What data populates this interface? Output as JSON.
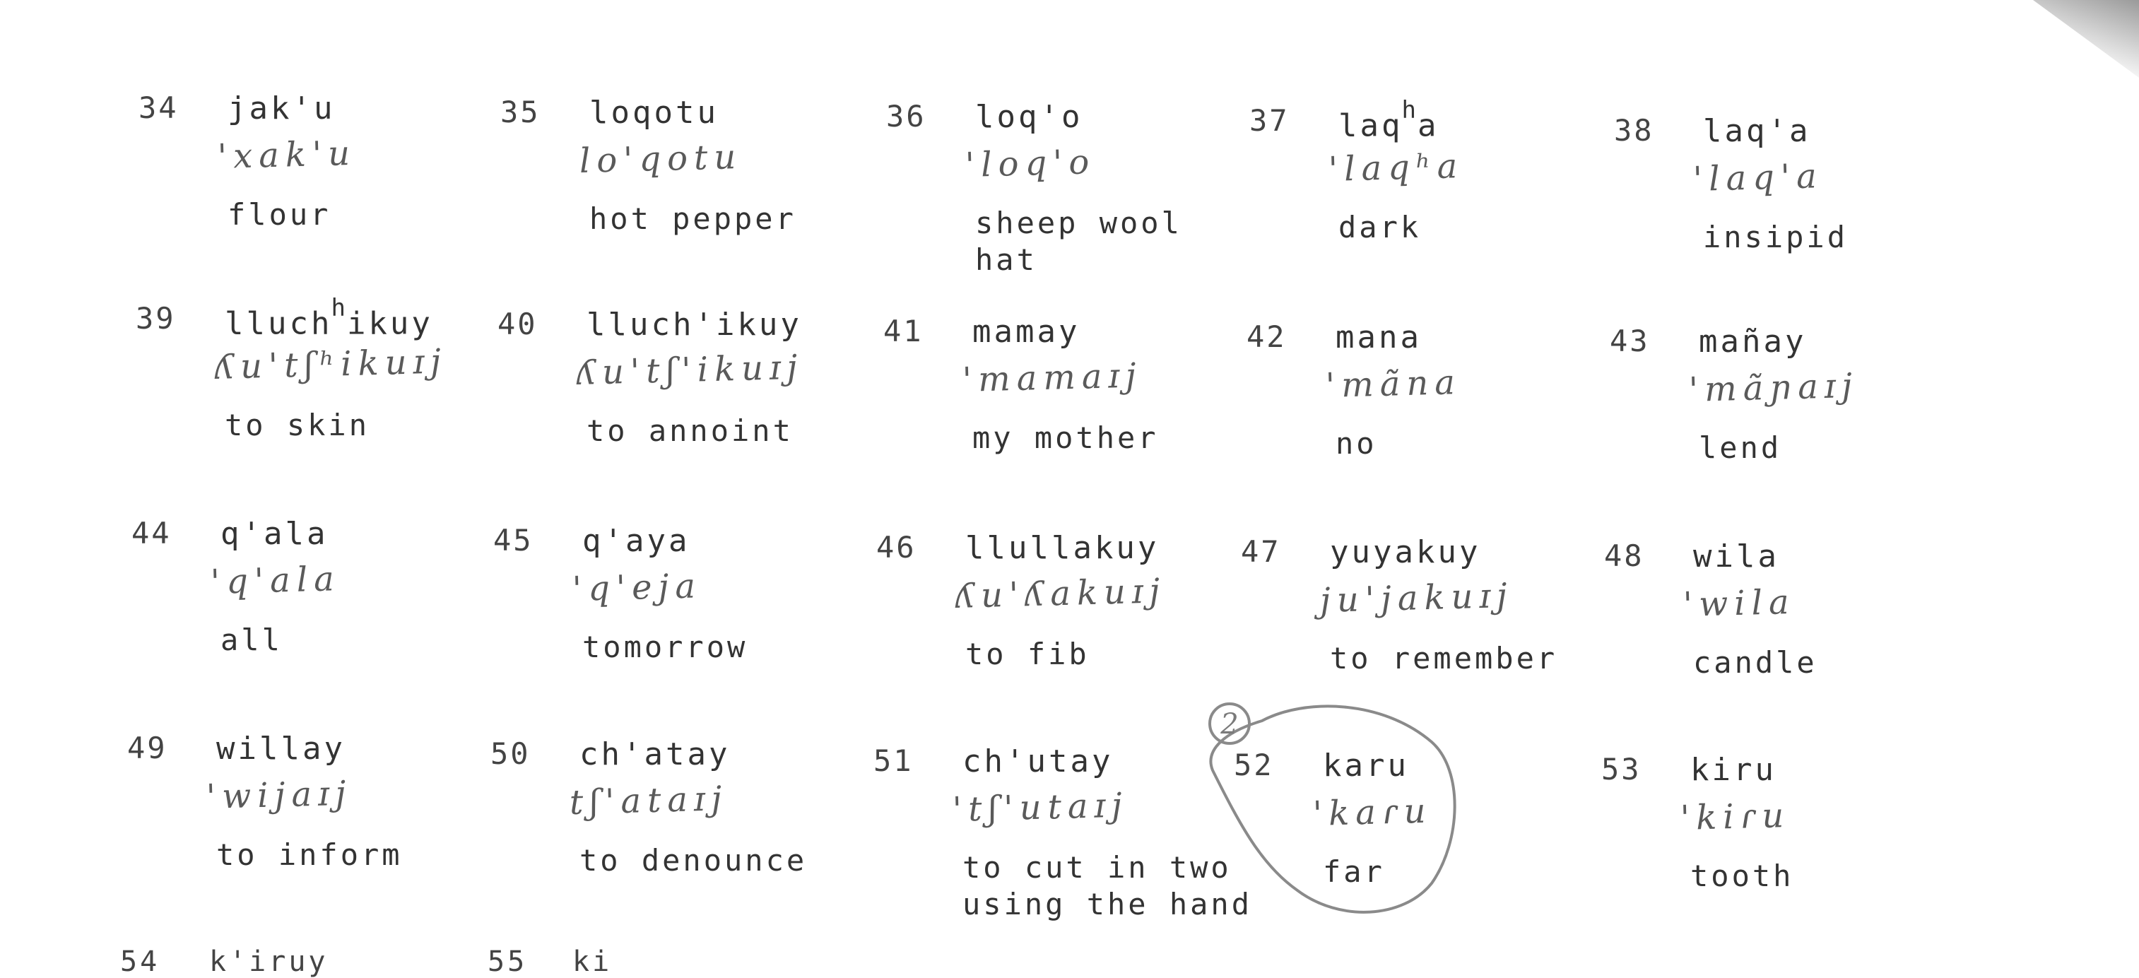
{
  "entries": [
    {
      "num": "34",
      "word": "jak'u",
      "ipa": "'xak'u",
      "gloss": "flour"
    },
    {
      "num": "35",
      "word": "loqotu",
      "ipa": "lo'qotu",
      "gloss": "hot pepper"
    },
    {
      "num": "36",
      "word": "loq'o",
      "ipa": "'loq'o",
      "gloss": "sheep wool\nhat"
    },
    {
      "num": "37",
      "word": "laq",
      "word_sup": "h",
      "word_rest": "a",
      "ipa": "'laqʰa",
      "gloss": "dark"
    },
    {
      "num": "38",
      "word": "laq'a",
      "ipa": "'laq'a",
      "gloss": "insipid"
    },
    {
      "num": "39",
      "word": "lluch",
      "word_sup": "h",
      "word_rest": "ikuy",
      "ipa": "ʎu'tʃʰikuɪj",
      "gloss": "to skin"
    },
    {
      "num": "40",
      "word": "lluch'ikuy",
      "ipa": "ʎu'tʃ'ikuɪj",
      "gloss": "to annoint"
    },
    {
      "num": "41",
      "word": "mamay",
      "ipa": "'mamaɪj",
      "gloss": "my mother"
    },
    {
      "num": "42",
      "word": "mana",
      "ipa": "'mãna",
      "gloss": "no"
    },
    {
      "num": "43",
      "word": "mañay",
      "ipa": "'mãɲaɪj",
      "gloss": "lend"
    },
    {
      "num": "44",
      "word": "q'ala",
      "ipa": "'q'ala",
      "gloss": "all"
    },
    {
      "num": "45",
      "word": "q'aya",
      "ipa": "'q'eja",
      "gloss": "tomorrow"
    },
    {
      "num": "46",
      "word": "llullakuy",
      "ipa": "ʎu'ʎakuɪj",
      "gloss": "to fib"
    },
    {
      "num": "47",
      "word": "yuyakuy",
      "ipa": "ju'jakuɪj",
      "gloss": "to remember"
    },
    {
      "num": "48",
      "word": "wila",
      "ipa": "'wila",
      "gloss": "candle"
    },
    {
      "num": "49",
      "word": "willay",
      "ipa": "'wijaɪj",
      "gloss": "to inform"
    },
    {
      "num": "50",
      "word": "ch'atay",
      "ipa": "tʃ'ataɪj",
      "gloss": "to denounce"
    },
    {
      "num": "51",
      "word": "ch'utay",
      "ipa": "'tʃ'utaɪj",
      "gloss": "to cut in two\nusing the hand"
    },
    {
      "num": "52",
      "word": "karu",
      "ipa": "'kaɾu",
      "gloss": "far"
    },
    {
      "num": "53",
      "word": "kiru",
      "ipa": "'kiɾu",
      "gloss": "tooth"
    }
  ],
  "annotation": {
    "circle_label": "2"
  },
  "cut_row": {
    "left_num": "54",
    "left_word": "k'iruy",
    "right_num": "55",
    "right_word": "ki"
  }
}
